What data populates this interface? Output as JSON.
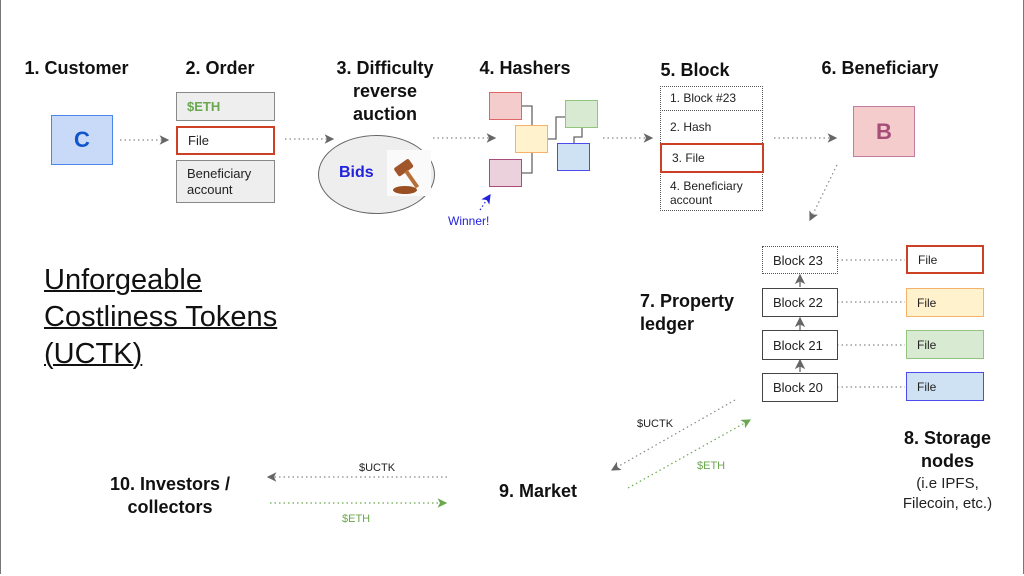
{
  "steps": {
    "customer": {
      "label": "1. Customer",
      "glyph": "C"
    },
    "order": {
      "label": "2. Order",
      "items": [
        "$ETH",
        "File",
        "Beneficiary account"
      ]
    },
    "auction": {
      "label_lines": [
        "3. Difficulty",
        "reverse",
        "auction"
      ],
      "bids": "Bids",
      "icon": "gavel-icon"
    },
    "hashers": {
      "label": "4. Hashers",
      "winner": "Winner!"
    },
    "block": {
      "label": "5. Block",
      "items": [
        "1. Block #23",
        "2. Hash",
        "3. File",
        "4. Beneficiary account"
      ]
    },
    "beneficiary": {
      "label": "6. Beneficiary",
      "glyph": "B"
    },
    "ledger": {
      "label_lines": [
        "7. Property",
        "ledger"
      ],
      "blocks": [
        "Block 23",
        "Block 22",
        "Block 21",
        "Block 20"
      ],
      "file_label": "File"
    },
    "storage": {
      "label_lines": [
        "8. Storage",
        "nodes"
      ],
      "note_lines": [
        "(i.e IPFS,",
        "Filecoin, etc.)"
      ]
    },
    "market": {
      "label": "9. Market"
    },
    "investors": {
      "label_lines": [
        "10. Investors /",
        "collectors"
      ]
    }
  },
  "flows": {
    "uctk": "$UCTK",
    "eth": "$ETH"
  },
  "title_lines": [
    "Unforgeable",
    "Costliness Tokens",
    "(UCTK)"
  ],
  "colors": {
    "eth_green": "#6aa84f",
    "file_red": "#cc4125",
    "link_gray": "#888888",
    "winner_blue": "#2222dd"
  }
}
